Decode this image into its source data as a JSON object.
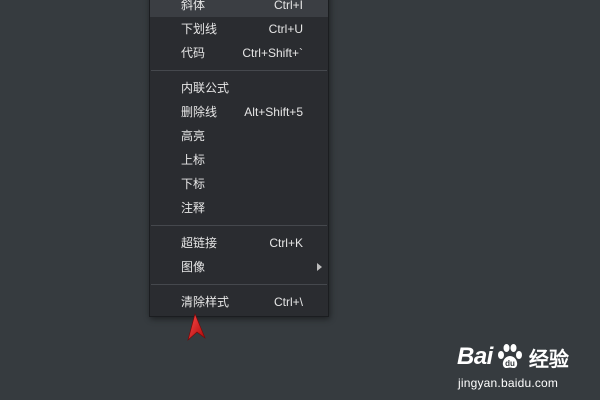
{
  "context_menu": {
    "items": [
      {
        "label": "斜体",
        "shortcut": "Ctrl+I"
      },
      {
        "label": "下划线",
        "shortcut": "Ctrl+U"
      },
      {
        "label": "代码",
        "shortcut": "Ctrl+Shift+`"
      },
      {
        "label": "内联公式",
        "shortcut": ""
      },
      {
        "label": "删除线",
        "shortcut": "Alt+Shift+5"
      },
      {
        "label": "高亮",
        "shortcut": ""
      },
      {
        "label": "上标",
        "shortcut": ""
      },
      {
        "label": "下标",
        "shortcut": ""
      },
      {
        "label": "注释",
        "shortcut": ""
      },
      {
        "label": "超链接",
        "shortcut": "Ctrl+K"
      },
      {
        "label": "图像",
        "shortcut": ""
      },
      {
        "label": "清除样式",
        "shortcut": "Ctrl+\\"
      }
    ]
  },
  "watermark": {
    "brand": "Bai",
    "brand_suffix": "经验",
    "url": "jingyan.baidu.com"
  },
  "colors": {
    "background": "#363b3f",
    "menu_background": "#2a2c30",
    "menu_text": "#e6e6e6",
    "pointer_arrow": "#d01818"
  }
}
